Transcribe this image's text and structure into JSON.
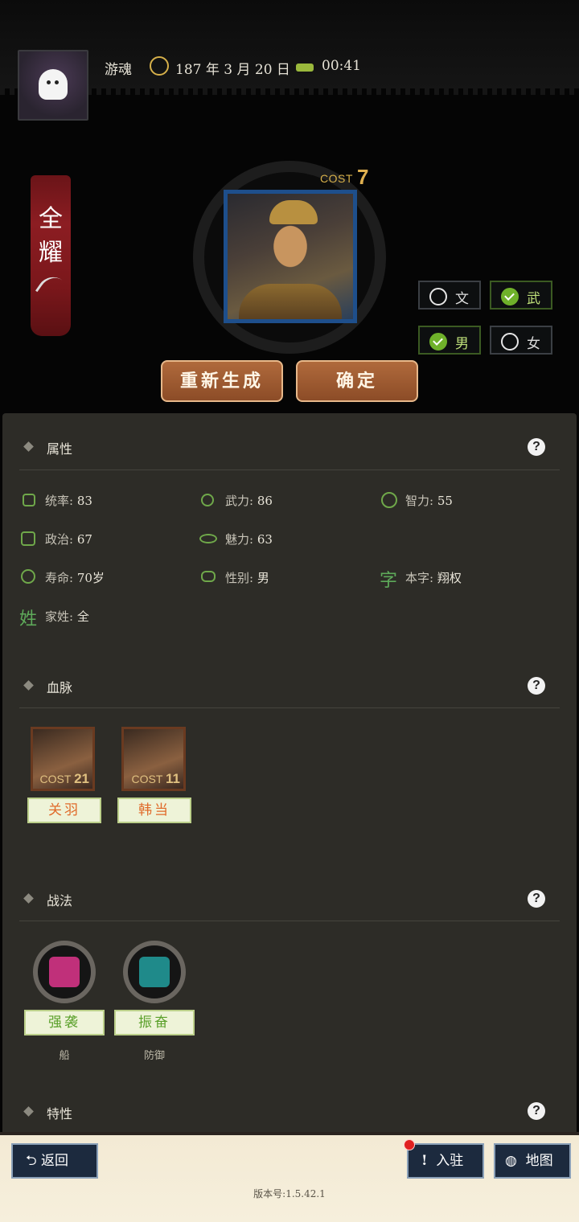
{
  "header": {
    "player_name": "游魂",
    "date": "187 年 3 月 20 日",
    "time": "00:41",
    "date_icon": "year-badge-icon",
    "time_icon": "horse-icon"
  },
  "banner": {
    "line1": "全",
    "line2": "耀",
    "icon": "feather-icon"
  },
  "portrait": {
    "cost_label": "COST",
    "cost_value": "7"
  },
  "toggles": {
    "wen": {
      "label": "文",
      "checked": false
    },
    "wu": {
      "label": "武",
      "checked": true
    },
    "male": {
      "label": "男",
      "checked": true
    },
    "female": {
      "label": "女",
      "checked": false
    }
  },
  "actions": {
    "regenerate": "重新生成",
    "confirm": "确定"
  },
  "sections": {
    "attributes": {
      "title": "属性",
      "help": "?"
    },
    "lineage": {
      "title": "血脉",
      "help": "?"
    },
    "tactics": {
      "title": "战法",
      "help": "?"
    },
    "traits": {
      "title": "特性",
      "help": "?"
    }
  },
  "stats": {
    "tongshuai": {
      "label": "统率:",
      "value": "83"
    },
    "wuli": {
      "label": "武力:",
      "value": "86"
    },
    "zhili": {
      "label": "智力:",
      "value": "55"
    },
    "zhengzhi": {
      "label": "政治:",
      "value": "67"
    },
    "meili": {
      "label": "魅力:",
      "value": "63"
    },
    "shouming": {
      "label": "寿命:",
      "value": "70岁"
    },
    "xingbie": {
      "label": "性别:",
      "value": "男"
    },
    "benzi": {
      "glyph": "字",
      "label": "本字:",
      "value": "翔权"
    },
    "jiaxing": {
      "glyph": "姓",
      "label": "家姓:",
      "value": "全"
    }
  },
  "lineage": [
    {
      "name": "关羽",
      "cost_label": "COST",
      "cost": "21"
    },
    {
      "name": "韩当",
      "cost_label": "COST",
      "cost": "11"
    }
  ],
  "tactics": [
    {
      "name": "强袭",
      "type": "船",
      "color": "#c0307a"
    },
    {
      "name": "振奋",
      "type": "防御",
      "color": "#1f8a8a"
    }
  ],
  "bottom": {
    "back": "返回",
    "join": "入驻",
    "map": "地图",
    "version": "版本号:1.5.42.1"
  }
}
